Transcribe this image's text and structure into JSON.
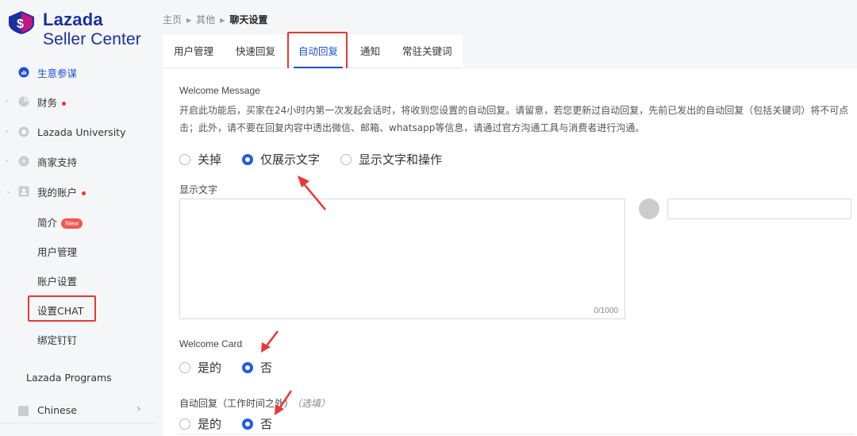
{
  "brand": {
    "name": "Lazada",
    "sub": "Seller Center",
    "logo_letter": "$"
  },
  "sidebar": {
    "items": [
      {
        "label": "生意参谋"
      },
      {
        "label": "财务"
      },
      {
        "label": "Lazada University"
      },
      {
        "label": "商家支持"
      },
      {
        "label": "我的账户"
      }
    ],
    "sub_items": [
      {
        "label": "简介",
        "badge": "New"
      },
      {
        "label": "用户管理"
      },
      {
        "label": "账户设置"
      },
      {
        "label": "设置CHAT"
      },
      {
        "label": "绑定钉钉"
      }
    ],
    "programs": "Lazada Programs",
    "language": "Chinese"
  },
  "breadcrumb": {
    "home": "主页",
    "other": "其他",
    "current": "聊天设置"
  },
  "tabs": [
    {
      "label": "用户管理"
    },
    {
      "label": "快速回复"
    },
    {
      "label": "自动回复"
    },
    {
      "label": "通知"
    },
    {
      "label": "常驻关键词"
    }
  ],
  "welcome": {
    "title": "Welcome Message",
    "description": "开启此功能后，买家在24小时内第一次发起会话时，将收到您设置的自动回复。请留意，若您更新过自动回复，先前已发出的自动回复（包括关键词）将不可点击；此外，请不要在回复内容中透出微信、邮箱、whatsapp等信息，请通过官方沟通工具与消费者进行沟通。",
    "options": [
      "关掉",
      "仅展示文字",
      "显示文字和操作"
    ],
    "selected": "仅展示文字",
    "text_label": "显示文字",
    "text_value": "",
    "counter": "0/1000",
    "preview_value": ""
  },
  "welcome_card": {
    "title": "Welcome Card",
    "options": [
      "是的",
      "否"
    ],
    "selected": "否"
  },
  "auto_reply": {
    "title": "自动回复（工作时间之外）",
    "optional": "（选填）",
    "options": [
      "是的",
      "否"
    ],
    "selected": "否"
  },
  "colors": {
    "brand": "#1a2fa0",
    "accent": "#1e4fd6",
    "highlight": "#e53935"
  }
}
